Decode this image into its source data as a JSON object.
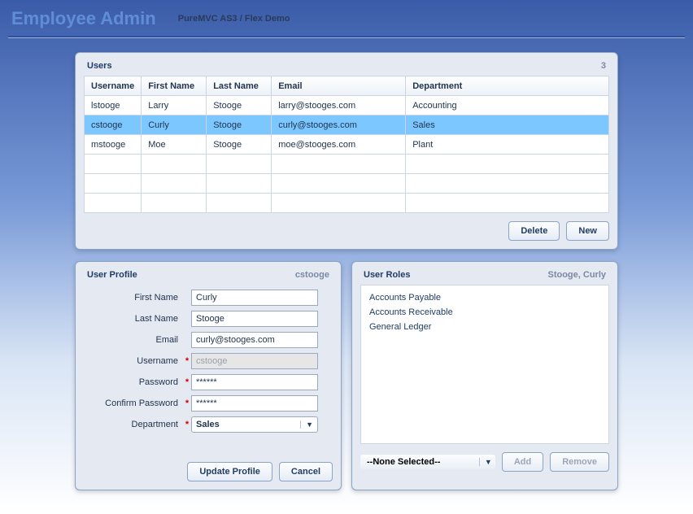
{
  "header": {
    "title": "Employee Admin",
    "subtitle": "PureMVC AS3 / Flex Demo"
  },
  "usersPanel": {
    "title": "Users",
    "count": "3",
    "columns": [
      "Username",
      "First Name",
      "Last Name",
      "Email",
      "Department"
    ],
    "rows": [
      {
        "username": "lstooge",
        "first": "Larry",
        "last": "Stooge",
        "email": "larry@stooges.com",
        "dept": "Accounting",
        "selected": false
      },
      {
        "username": "cstooge",
        "first": "Curly",
        "last": "Stooge",
        "email": "curly@stooges.com",
        "dept": "Sales",
        "selected": true
      },
      {
        "username": "mstooge",
        "first": "Moe",
        "last": "Stooge",
        "email": "moe@stooges.com",
        "dept": "Plant",
        "selected": false
      }
    ],
    "emptyRows": 3,
    "buttons": {
      "delete": "Delete",
      "new": "New"
    }
  },
  "profile": {
    "title": "User Profile",
    "subtitle": "cstooge",
    "fields": {
      "firstName": {
        "label": "First Name",
        "value": "Curly"
      },
      "lastName": {
        "label": "Last Name",
        "value": "Stooge"
      },
      "email": {
        "label": "Email",
        "value": "curly@stooges.com"
      },
      "username": {
        "label": "Username",
        "value": "cstooge"
      },
      "password": {
        "label": "Password",
        "value": "******"
      },
      "confirm": {
        "label": "Confirm Password",
        "value": "******"
      },
      "department": {
        "label": "Department",
        "value": "Sales"
      }
    },
    "buttons": {
      "update": "Update Profile",
      "cancel": "Cancel"
    }
  },
  "roles": {
    "title": "User Roles",
    "subtitle": "Stooge, Curly",
    "items": [
      "Accounts Payable",
      "Accounts Receivable",
      "General Ledger"
    ],
    "selectLabel": "--None Selected--",
    "buttons": {
      "add": "Add",
      "remove": "Remove"
    }
  }
}
